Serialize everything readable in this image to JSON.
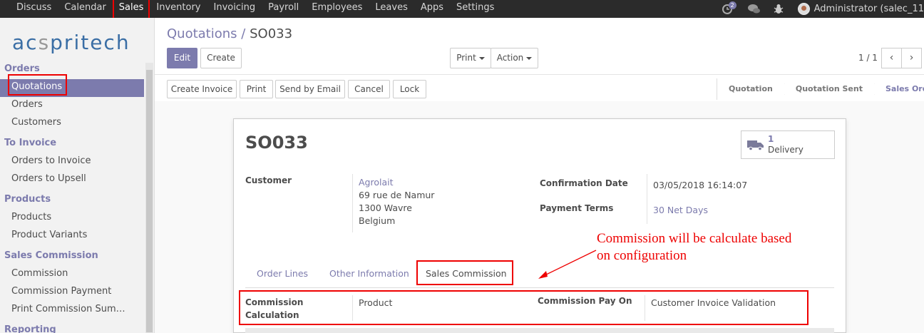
{
  "topnav": [
    "Discuss",
    "Calendar",
    "Sales",
    "Inventory",
    "Invoicing",
    "Payroll",
    "Employees",
    "Leaves",
    "Apps",
    "Settings"
  ],
  "topnav_active": "Sales",
  "topbar": {
    "activity_badge": "2",
    "user": "Administrator (salec_11"
  },
  "logo": {
    "prefix": "ac",
    "accent": "s",
    "suffix": "pritech"
  },
  "sidebar": {
    "sections": [
      {
        "title": "Orders",
        "items": [
          "Quotations",
          "Orders",
          "Customers"
        ]
      },
      {
        "title": "To Invoice",
        "items": [
          "Orders to Invoice",
          "Orders to Upsell"
        ]
      },
      {
        "title": "Products",
        "items": [
          "Products",
          "Product Variants"
        ]
      },
      {
        "title": "Sales Commission",
        "items": [
          "Commission",
          "Commission Payment",
          "Print Commission Sum…"
        ]
      },
      {
        "title": "Reporting",
        "items": []
      }
    ],
    "active_item": "Quotations"
  },
  "breadcrumb": {
    "parent": "Quotations",
    "separator": "/",
    "current": "SO033"
  },
  "control": {
    "edit": "Edit",
    "create": "Create",
    "print": "Print",
    "action": "Action",
    "pager": "1 / 1",
    "prev": "‹",
    "next": "›"
  },
  "actions": [
    "Create Invoice",
    "Print",
    "Send by Email",
    "Cancel",
    "Lock"
  ],
  "stages": [
    "Quotation",
    "Quotation Sent",
    "Sales Order"
  ],
  "current_stage": "Sales Order",
  "record": {
    "name": "SO033",
    "smart_button": {
      "count": "1",
      "label": "Delivery"
    },
    "customer_label": "Customer",
    "customer_name": "Agrolait",
    "address": [
      "69 rue de Namur",
      "1300 Wavre",
      "Belgium"
    ],
    "confirmation_date_label": "Confirmation Date",
    "confirmation_date": "03/05/2018 16:14:07",
    "payment_terms_label": "Payment Terms",
    "payment_terms": "30 Net Days"
  },
  "tabs": [
    "Order Lines",
    "Other Information",
    "Sales Commission"
  ],
  "active_tab": "Sales Commission",
  "commission": {
    "calc_label_1": "Commission",
    "calc_label_2": "Calculation",
    "calc_value": "Product",
    "pay_on_label": "Commission Pay On",
    "pay_on_value": "Customer Invoice Validation"
  },
  "annotation": {
    "line1": "Commission will be calculate based",
    "line2": "on configuration"
  },
  "colors": {
    "accent": "#7c7bad",
    "topbar": "#2b2b2b",
    "highlight": "#ee0000"
  }
}
